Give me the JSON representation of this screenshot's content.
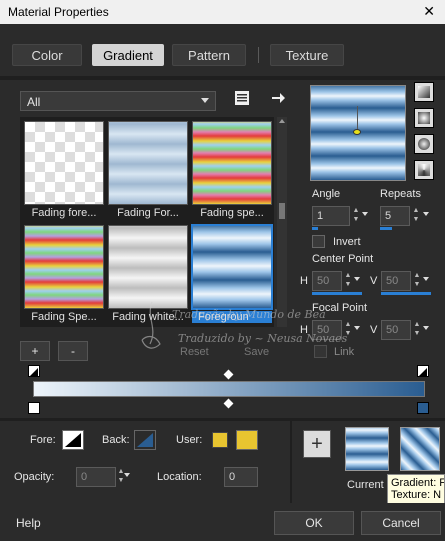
{
  "window": {
    "title": "Material Properties",
    "close": "✕"
  },
  "tabs": [
    {
      "label": "Color"
    },
    {
      "label": "Gradient"
    },
    {
      "label": "Pattern"
    },
    {
      "label": "Texture"
    }
  ],
  "category": {
    "value": "All"
  },
  "gradients": [
    {
      "label": "Fading fore..."
    },
    {
      "label": "Fading For..."
    },
    {
      "label": "Fading spe..."
    },
    {
      "label": "Fading Spe..."
    },
    {
      "label": "Fading white..."
    },
    {
      "label": "Foregroun"
    }
  ],
  "angle": {
    "label": "Angle",
    "value": "1"
  },
  "repeats": {
    "label": "Repeats",
    "value": "5"
  },
  "invert": {
    "label": "Invert"
  },
  "center_point": {
    "label": "Center Point",
    "h_label": "H",
    "h": "50",
    "v_label": "V",
    "v": "50"
  },
  "focal_point": {
    "label": "Focal Point",
    "h_label": "H",
    "h": "50",
    "v_label": "V",
    "v": "50"
  },
  "link": {
    "label": "Link"
  },
  "reset_label": "Reset",
  "save_label": "Save",
  "add_stop_label": "+",
  "remove_stop_label": "-",
  "fore": {
    "label": "Fore:"
  },
  "back": {
    "label": "Back:"
  },
  "user": {
    "label": "User:",
    "color": "#e8c530"
  },
  "opacity": {
    "label": "Opacity:",
    "value": "0"
  },
  "location": {
    "label": "Location:",
    "value": "0"
  },
  "current": {
    "label": "Current",
    "add_label": "+"
  },
  "tooltip": {
    "line1": "Gradient: F",
    "line2": "Texture: N"
  },
  "watermark": {
    "line1": "Tradução by Mundo de Bea",
    "line2": "Traduzido by ~ Neusa Novaes"
  },
  "help_label": "Help",
  "ok_label": "OK",
  "cancel_label": "Cancel",
  "colors": {
    "accent": "#2a7fd4",
    "gradient_dark": "#2a5d91",
    "gradient_light": "#eef5fb"
  }
}
